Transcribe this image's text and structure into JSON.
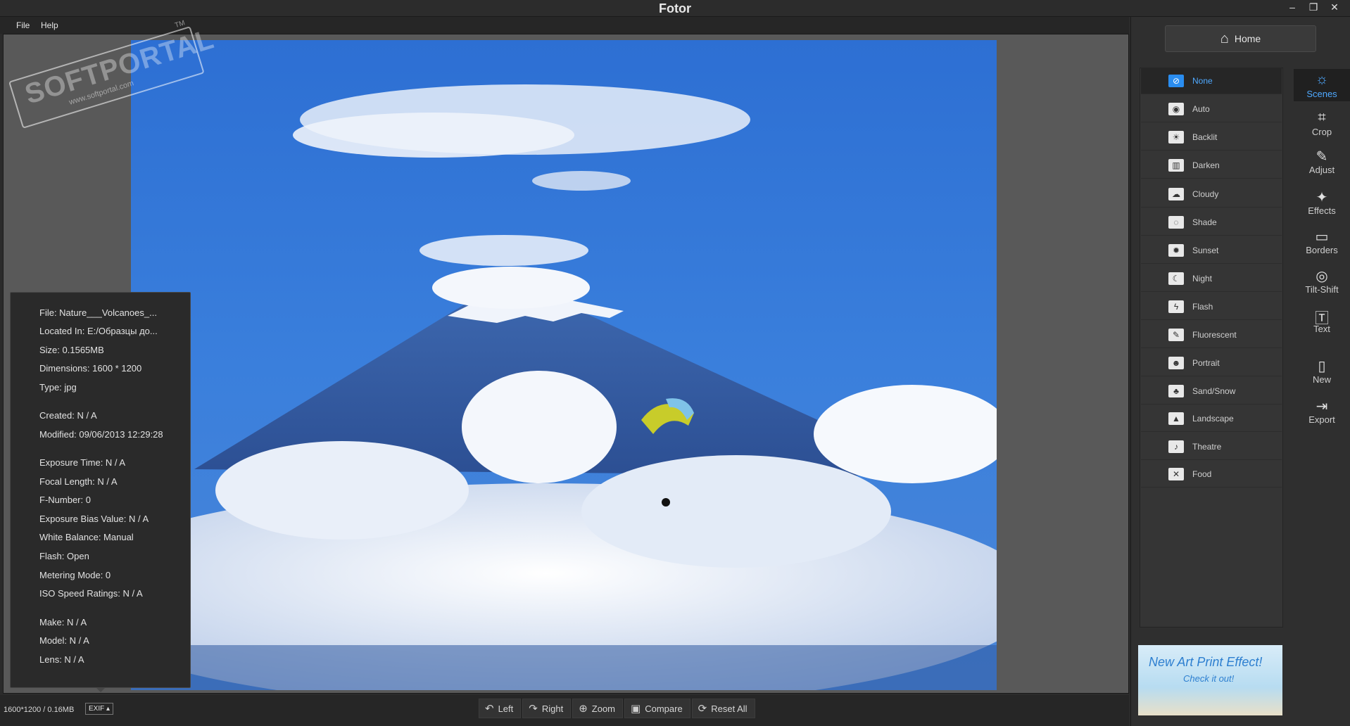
{
  "app": {
    "title": "Fotor"
  },
  "window_controls": {
    "minimize": "–",
    "restore": "❐",
    "close": "✕"
  },
  "menu": {
    "file": "File",
    "help": "Help"
  },
  "watermark": {
    "text": "SOFTPORTAL",
    "sub": "www.softportal.com",
    "tm": "TM"
  },
  "exif": {
    "rows": [
      "File: Nature___Volcanoes_...",
      "Located In: E:/Образцы до...",
      "Size: 0.1565MB",
      "Dimensions: 1600 * 1200",
      "Type: jpg",
      "Created: N / A",
      "Modified: 09/06/2013 12:29:28",
      "Exposure Time: N / A",
      "Focal Length: N / A",
      "F-Number: 0",
      "Exposure Bias Value: N / A",
      "White Balance: Manual",
      "Flash: Open",
      "Metering Mode: 0",
      "ISO Speed Ratings: N / A",
      "Make: N / A",
      "Model: N / A",
      "Lens: N / A"
    ]
  },
  "bottombar": {
    "status": "1600*1200 / 0.16MB",
    "exif_button": "EXIF ▴",
    "tools": [
      {
        "label": "Left",
        "icon": "rotate-left-icon"
      },
      {
        "label": "Right",
        "icon": "rotate-right-icon"
      },
      {
        "label": "Zoom",
        "icon": "zoom-icon"
      },
      {
        "label": "Compare",
        "icon": "compare-icon"
      },
      {
        "label": "Reset All",
        "icon": "reset-icon"
      }
    ]
  },
  "right_panel": {
    "home": "Home",
    "scenes": [
      "None",
      "Auto",
      "Backlit",
      "Darken",
      "Cloudy",
      "Shade",
      "Sunset",
      "Night",
      "Flash",
      "Fluorescent",
      "Portrait",
      "Sand/Snow",
      "Landscape",
      "Theatre",
      "Food"
    ],
    "selected_scene": "None",
    "tools": [
      {
        "label": "Scenes",
        "icon": "sun-icon"
      },
      {
        "label": "Crop",
        "icon": "crop-icon"
      },
      {
        "label": "Adjust",
        "icon": "pencil-icon"
      },
      {
        "label": "Effects",
        "icon": "sparkle-icon"
      },
      {
        "label": "Borders",
        "icon": "border-icon"
      },
      {
        "label": "Tilt-Shift",
        "icon": "target-icon"
      },
      {
        "label": "Text",
        "icon": "text-icon"
      },
      {
        "label": "New",
        "icon": "new-file-icon"
      },
      {
        "label": "Export",
        "icon": "export-icon"
      }
    ],
    "active_tool": "Scenes",
    "ad": {
      "title": "New Art Print Effect!",
      "sub": "Check it out!"
    }
  },
  "colors": {
    "accent": "#4fa9ff",
    "panel": "#2f2f2f",
    "canvas": "#595959"
  }
}
